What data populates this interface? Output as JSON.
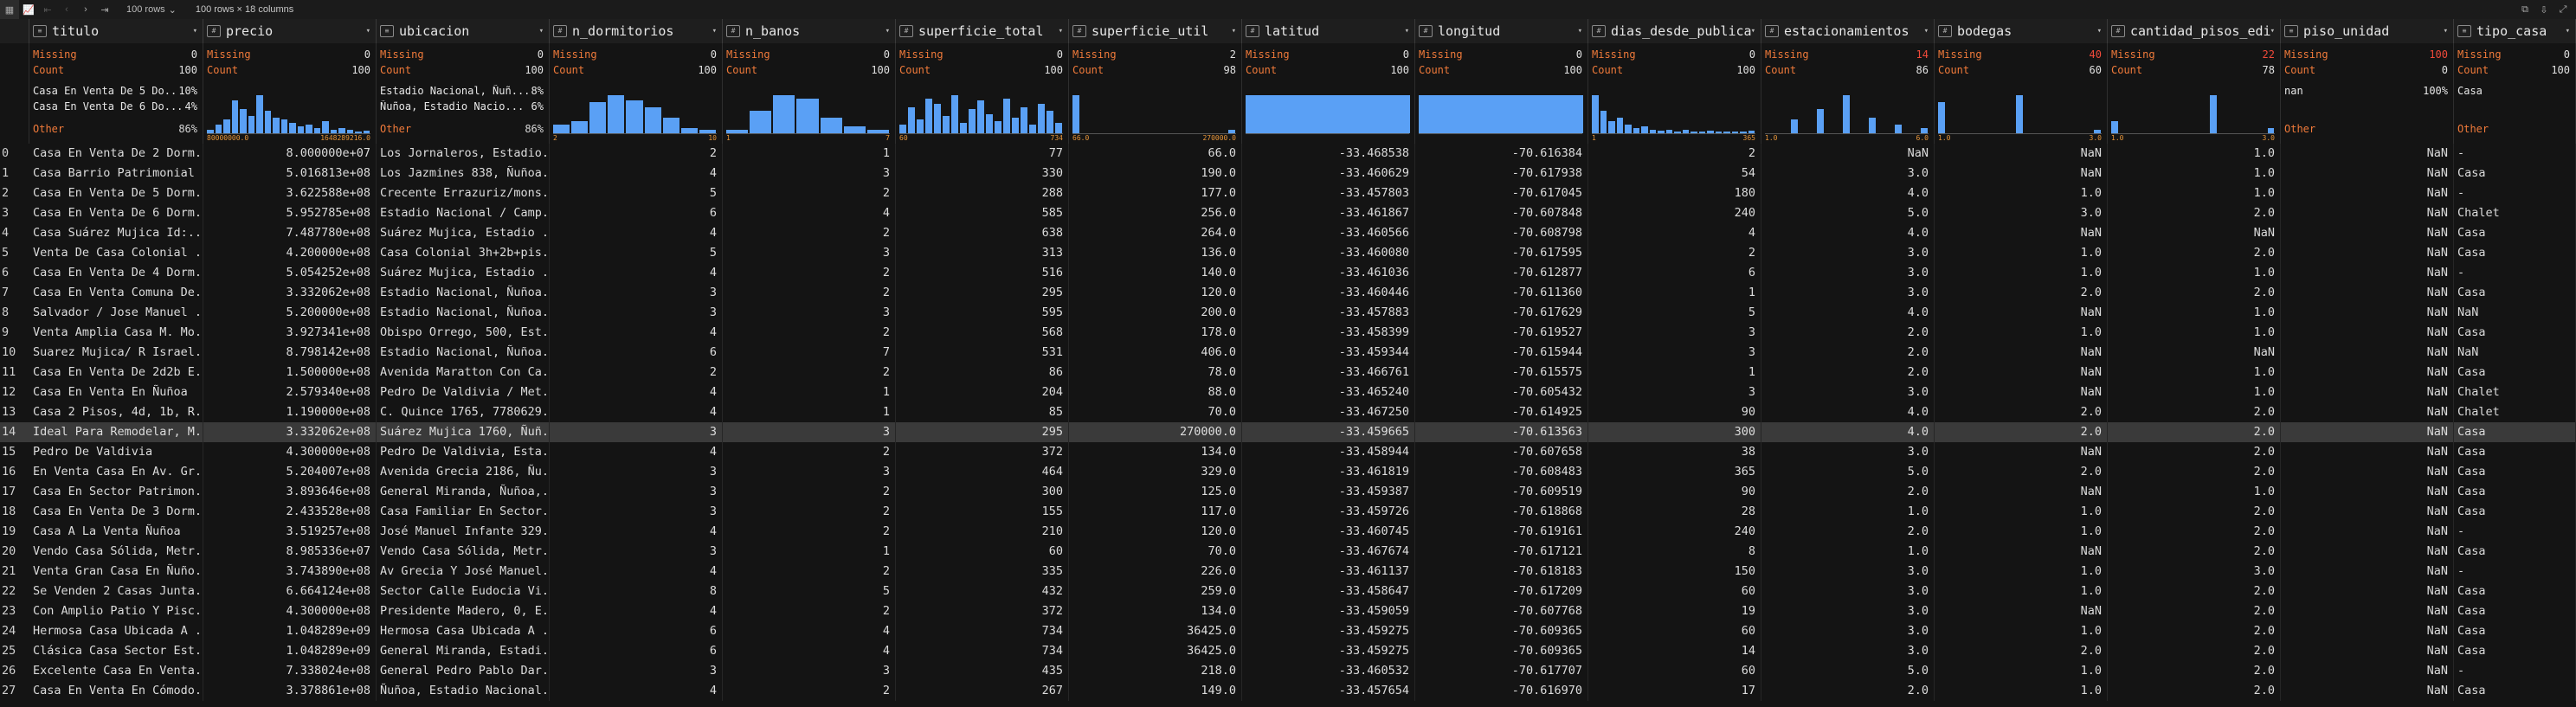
{
  "toolbar": {
    "rows_option": "100 rows",
    "shape_text": "100 rows × 18 columns",
    "icons": [
      "table-icon",
      "chart-icon",
      "first-page-icon",
      "prev-page-icon",
      "next-page-icon",
      "last-page-icon",
      "copy-icon",
      "export-icon",
      "expand-icon"
    ]
  },
  "columns": [
    {
      "name": "titulo",
      "type": "text",
      "missing": "0",
      "count": "100",
      "top": [
        [
          "Casa En Venta De 5 Do...",
          "10%"
        ],
        [
          "Casa En Venta De 6 Do...",
          "4%"
        ]
      ],
      "other": "86%"
    },
    {
      "name": "precio",
      "type": "numeric",
      "missing": "0",
      "count": "100",
      "hist": [
        4,
        10,
        16,
        38,
        28,
        20,
        44,
        26,
        18,
        16,
        12,
        8,
        10,
        6,
        14,
        4,
        6,
        4,
        2,
        3
      ],
      "range": [
        "80000000.0",
        "1648289216.0"
      ]
    },
    {
      "name": "ubicacion",
      "type": "text",
      "missing": "0",
      "count": "100",
      "top": [
        [
          "Estadio Nacional, Ñuñ...",
          "8%"
        ],
        [
          "Ñuñoa, Estadio Nacio...",
          "6%"
        ]
      ],
      "other": "86%"
    },
    {
      "name": "n_dormitorios",
      "type": "numeric",
      "missing": "0",
      "count": "100",
      "hist": [
        10,
        14,
        36,
        44,
        38,
        30,
        18,
        6,
        4
      ],
      "range": [
        "2",
        "10"
      ]
    },
    {
      "name": "n_banos",
      "type": "numeric",
      "missing": "0",
      "count": "100",
      "hist": [
        4,
        26,
        44,
        40,
        18,
        8,
        4
      ],
      "range": [
        "1",
        "7"
      ]
    },
    {
      "name": "superficie_total",
      "type": "numeric",
      "missing": "0",
      "count": "100",
      "hist": [
        10,
        30,
        16,
        40,
        34,
        20,
        44,
        12,
        28,
        38,
        22,
        14,
        40,
        18,
        30,
        10,
        34,
        26,
        12
      ],
      "range": [
        "60",
        "734"
      ]
    },
    {
      "name": "superficie_util",
      "type": "numeric",
      "missing": "2",
      "count": "98",
      "hist": [
        44,
        0,
        0,
        0,
        0,
        0,
        0,
        0,
        0,
        0,
        0,
        0,
        0,
        0,
        0,
        0,
        0,
        0,
        4
      ],
      "range": [
        "66.0",
        "270000.0"
      ]
    },
    {
      "name": "latitud",
      "type": "numeric",
      "missing": "0",
      "count": "100",
      "hist": [
        44
      ],
      "range": [
        "",
        ""
      ]
    },
    {
      "name": "longitud",
      "type": "numeric",
      "missing": "0",
      "count": "100",
      "hist": [
        44
      ],
      "range": [
        "",
        ""
      ]
    },
    {
      "name": "dias_desde_publica...",
      "type": "numeric",
      "missing": "0",
      "count": "100",
      "hist": [
        44,
        26,
        14,
        18,
        10,
        6,
        8,
        4,
        3,
        4,
        2,
        4,
        2,
        2,
        3,
        2,
        2,
        2,
        2,
        3
      ],
      "range": [
        "1",
        "365"
      ]
    },
    {
      "name": "estacionamientos",
      "type": "numeric",
      "missing": "14",
      "count": "86",
      "missing_red": true,
      "hist": [
        0,
        0,
        0,
        16,
        0,
        0,
        28,
        0,
        0,
        44,
        0,
        0,
        18,
        0,
        0,
        10,
        0,
        0,
        6
      ],
      "range": [
        "1.0",
        "6.0"
      ]
    },
    {
      "name": "bodegas",
      "type": "numeric",
      "missing": "40",
      "count": "60",
      "missing_red": true,
      "hist": [
        36,
        0,
        0,
        0,
        0,
        0,
        0,
        0,
        0,
        44,
        0,
        0,
        0,
        0,
        0,
        0,
        0,
        0,
        4
      ],
      "range": [
        "1.0",
        "3.0"
      ]
    },
    {
      "name": "cantidad_pisos_edi...",
      "type": "numeric",
      "missing": "22",
      "count": "78",
      "missing_red": true,
      "hist": [
        14,
        0,
        0,
        0,
        0,
        0,
        0,
        0,
        0,
        0,
        0,
        0,
        44,
        0,
        0,
        0,
        0,
        0,
        0,
        6
      ],
      "range": [
        "1.0",
        "3.0"
      ]
    },
    {
      "name": "piso_unidad",
      "type": "text",
      "missing": "100",
      "count": "0",
      "missing_red": true,
      "top": [
        [
          "nan",
          "100%"
        ]
      ],
      "other": ""
    },
    {
      "name": "tipo_casa",
      "type": "text",
      "missing": "0",
      "count": "100",
      "top": [
        [
          "Casa",
          ""
        ]
      ],
      "other": ""
    }
  ],
  "labels": {
    "missing": "Missing",
    "count": "Count",
    "other": "Other"
  },
  "rows": [
    [
      "0",
      "Casa En Venta De 2 Dorm...",
      "8.000000e+07",
      "Los Jornaleros, Estadio...",
      "2",
      "1",
      "77",
      "66.0",
      "-33.468538",
      "-70.616384",
      "2",
      "NaN",
      "NaN",
      "1.0",
      "NaN",
      "-"
    ],
    [
      "1",
      "Casa Barrio Patrimonial",
      "5.016813e+08",
      "Los Jazmines 838, Ñuñoa...",
      "4",
      "3",
      "330",
      "190.0",
      "-33.460629",
      "-70.617938",
      "54",
      "3.0",
      "NaN",
      "1.0",
      "NaN",
      "Casa"
    ],
    [
      "2",
      "Casa En Venta De 5 Dorm...",
      "3.622588e+08",
      "Crecente Errazuriz/mons...",
      "5",
      "2",
      "288",
      "177.0",
      "-33.457803",
      "-70.617045",
      "180",
      "4.0",
      "1.0",
      "1.0",
      "NaN",
      "-"
    ],
    [
      "3",
      "Casa En Venta De 6 Dorm...",
      "5.952785e+08",
      "Estadio Nacional / Camp...",
      "6",
      "4",
      "585",
      "256.0",
      "-33.461867",
      "-70.607848",
      "240",
      "5.0",
      "3.0",
      "2.0",
      "NaN",
      "Chalet"
    ],
    [
      "4",
      "Casa Suárez Mujica Id:...",
      "7.487780e+08",
      "Suárez Mujica, Estadio ...",
      "4",
      "2",
      "638",
      "264.0",
      "-33.460566",
      "-70.608798",
      "4",
      "4.0",
      "NaN",
      "NaN",
      "NaN",
      "Casa"
    ],
    [
      "5",
      "Venta De Casa Colonial ...",
      "4.200000e+08",
      "Casa Colonial 3h+2b+pis...",
      "5",
      "3",
      "313",
      "136.0",
      "-33.460080",
      "-70.617595",
      "2",
      "3.0",
      "1.0",
      "2.0",
      "NaN",
      "Casa"
    ],
    [
      "6",
      "Casa En Venta De 4 Dorm...",
      "5.054252e+08",
      "Suárez Mujica, Estadio ...",
      "4",
      "2",
      "516",
      "140.0",
      "-33.461036",
      "-70.612877",
      "6",
      "3.0",
      "1.0",
      "1.0",
      "NaN",
      "-"
    ],
    [
      "7",
      "Casa En Venta Comuna De...",
      "3.332062e+08",
      "Estadio Nacional, Ñuñoa...",
      "3",
      "2",
      "295",
      "120.0",
      "-33.460446",
      "-70.611360",
      "1",
      "3.0",
      "2.0",
      "2.0",
      "NaN",
      "Casa"
    ],
    [
      "8",
      "Salvador / Jose Manuel ...",
      "5.200000e+08",
      "Estadio Nacional, Ñuñoa...",
      "3",
      "3",
      "595",
      "200.0",
      "-33.457883",
      "-70.617629",
      "5",
      "4.0",
      "NaN",
      "1.0",
      "NaN",
      "NaN"
    ],
    [
      "9",
      "Venta Amplia Casa M. Mo...",
      "3.927341e+08",
      "Obispo Orrego, 500, Est...",
      "4",
      "2",
      "568",
      "178.0",
      "-33.458399",
      "-70.619527",
      "3",
      "2.0",
      "1.0",
      "1.0",
      "NaN",
      "Casa"
    ],
    [
      "10",
      "Suarez Mujica/ R Israel...",
      "8.798142e+08",
      "Estadio Nacional, Ñuñoa...",
      "6",
      "7",
      "531",
      "406.0",
      "-33.459344",
      "-70.615944",
      "3",
      "2.0",
      "NaN",
      "NaN",
      "NaN",
      "NaN"
    ],
    [
      "11",
      "Casa En Venta De 2d2b E...",
      "1.500000e+08",
      "Avenida Maratton Con Ca...",
      "2",
      "2",
      "86",
      "78.0",
      "-33.466761",
      "-70.615575",
      "1",
      "2.0",
      "NaN",
      "1.0",
      "NaN",
      "Casa"
    ],
    [
      "12",
      "Casa En Venta En Ñuñoa",
      "2.579340e+08",
      "Pedro De Valdivia / Met...",
      "4",
      "1",
      "204",
      "88.0",
      "-33.465240",
      "-70.605432",
      "3",
      "3.0",
      "NaN",
      "1.0",
      "NaN",
      "Chalet"
    ],
    [
      "13",
      "Casa 2 Pisos, 4d, 1b, R...",
      "1.190000e+08",
      "C. Quince 1765, 7780629...",
      "4",
      "1",
      "85",
      "70.0",
      "-33.467250",
      "-70.614925",
      "90",
      "4.0",
      "2.0",
      "2.0",
      "NaN",
      "Chalet"
    ],
    [
      "14",
      "Ideal Para Remodelar, M...",
      "3.332062e+08",
      "Suárez Mujica 1760, Ñuñ...",
      "3",
      "3",
      "295",
      "270000.0",
      "-33.459665",
      "-70.613563",
      "300",
      "4.0",
      "2.0",
      "2.0",
      "NaN",
      "Casa"
    ],
    [
      "15",
      "Pedro De Valdivia",
      "4.300000e+08",
      "Pedro De Valdivia, Esta...",
      "4",
      "2",
      "372",
      "134.0",
      "-33.458944",
      "-70.607658",
      "38",
      "3.0",
      "NaN",
      "2.0",
      "NaN",
      "Casa"
    ],
    [
      "16",
      "En Venta Casa En Av. Gr...",
      "5.204007e+08",
      "Avenida Grecia 2186, Ñu...",
      "3",
      "3",
      "464",
      "329.0",
      "-33.461819",
      "-70.608483",
      "365",
      "5.0",
      "2.0",
      "2.0",
      "NaN",
      "Casa"
    ],
    [
      "17",
      "Casa En Sector Patrimon...",
      "3.893646e+08",
      "General Miranda, Ñuñoa,...",
      "3",
      "2",
      "300",
      "125.0",
      "-33.459387",
      "-70.609519",
      "90",
      "2.0",
      "NaN",
      "1.0",
      "NaN",
      "Casa"
    ],
    [
      "18",
      "Casa En Venta De 3 Dorm...",
      "2.433528e+08",
      "Casa Familiar En Sector...",
      "3",
      "2",
      "155",
      "117.0",
      "-33.459726",
      "-70.618868",
      "28",
      "1.0",
      "1.0",
      "2.0",
      "NaN",
      "Casa"
    ],
    [
      "19",
      "Casa A La Venta Ñuñoa",
      "3.519257e+08",
      "José Manuel Infante 329...",
      "4",
      "2",
      "210",
      "120.0",
      "-33.460745",
      "-70.619161",
      "240",
      "2.0",
      "1.0",
      "2.0",
      "NaN",
      "-"
    ],
    [
      "20",
      "Vendo Casa Sólida, Metr...",
      "8.985336e+07",
      "Vendo Casa Sólida, Metr...",
      "3",
      "1",
      "60",
      "70.0",
      "-33.467674",
      "-70.617121",
      "8",
      "1.0",
      "NaN",
      "2.0",
      "NaN",
      "Casa"
    ],
    [
      "21",
      "Venta Gran Casa En Ñuño...",
      "3.743890e+08",
      "Av Grecia Y José Manuel...",
      "4",
      "2",
      "335",
      "226.0",
      "-33.461137",
      "-70.618183",
      "150",
      "3.0",
      "1.0",
      "3.0",
      "NaN",
      "-"
    ],
    [
      "22",
      "Se Venden 2 Casas Junta...",
      "6.664124e+08",
      "Sector Calle Eudocia Vi...",
      "8",
      "5",
      "432",
      "259.0",
      "-33.458647",
      "-70.617209",
      "60",
      "3.0",
      "1.0",
      "2.0",
      "NaN",
      "Casa"
    ],
    [
      "23",
      "Con Amplio Patio Y Pisc...",
      "4.300000e+08",
      "Presidente Madero, 0, E...",
      "4",
      "2",
      "372",
      "134.0",
      "-33.459059",
      "-70.607768",
      "19",
      "3.0",
      "NaN",
      "2.0",
      "NaN",
      "Casa"
    ],
    [
      "24",
      "Hermosa Casa Ubicada A ...",
      "1.048289e+09",
      "Hermosa Casa Ubicada A ...",
      "6",
      "4",
      "734",
      "36425.0",
      "-33.459275",
      "-70.609365",
      "60",
      "3.0",
      "1.0",
      "2.0",
      "NaN",
      "Casa"
    ],
    [
      "25",
      "Clásica Casa Sector Est...",
      "1.048289e+09",
      "General Miranda, Estadi...",
      "6",
      "4",
      "734",
      "36425.0",
      "-33.459275",
      "-70.609365",
      "14",
      "3.0",
      "2.0",
      "2.0",
      "NaN",
      "Casa"
    ],
    [
      "26",
      "Excelente Casa En Venta...",
      "7.338024e+08",
      "General Pedro Pablo Dar...",
      "3",
      "3",
      "435",
      "218.0",
      "-33.460532",
      "-70.617707",
      "60",
      "5.0",
      "1.0",
      "2.0",
      "NaN",
      "-"
    ],
    [
      "27",
      "Casa En Venta En Cómodo...",
      "3.378861e+08",
      "Ñuñoa, Estadio Nacional...",
      "4",
      "2",
      "267",
      "149.0",
      "-33.457654",
      "-70.616970",
      "17",
      "2.0",
      "1.0",
      "2.0",
      "NaN",
      "Casa"
    ]
  ]
}
